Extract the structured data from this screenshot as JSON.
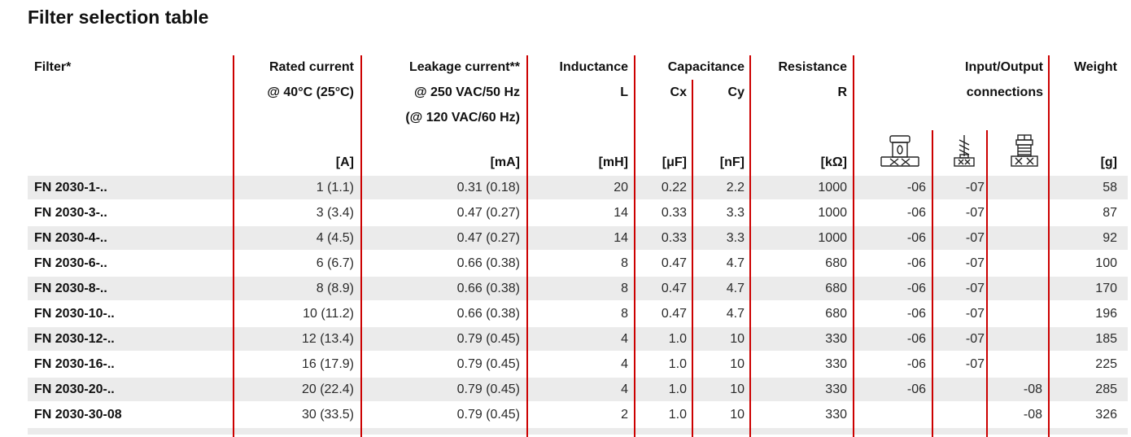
{
  "title": "Filter selection table",
  "header": {
    "filter": "Filter*",
    "rated_current": "Rated current",
    "rated_current_sub": "@ 40°C (25°C)",
    "rated_current_unit": "[A]",
    "leakage": "Leakage current**",
    "leakage_sub1": "@ 250 VAC/50 Hz",
    "leakage_sub2": "(@ 120 VAC/60 Hz)",
    "leakage_unit": "[mA]",
    "inductance": "Inductance",
    "inductance_sub": "L",
    "inductance_unit": "[mH]",
    "capacitance": "Capacitance",
    "cx": "Cx",
    "cx_unit": "[μF]",
    "cy": "Cy",
    "cy_unit": "[nF]",
    "resistance": "Resistance",
    "resistance_sub": "R",
    "resistance_unit": "[kΩ]",
    "io": "Input/Output",
    "io_sub": "connections",
    "weight": "Weight",
    "weight_unit": "[g]"
  },
  "icons": [
    "terminal-block-icon",
    "fast-on-terminal-icon",
    "screw-terminal-icon"
  ],
  "rows": [
    {
      "name": "FN 2030-1-..",
      "rated": "1 (1.1)",
      "leakage": "0.31 (0.18)",
      "l": "20",
      "cx": "0.22",
      "cy": "2.2",
      "r": "1000",
      "c06": "-06",
      "c07": "-07",
      "c08": "",
      "weight": "58"
    },
    {
      "name": "FN 2030-3-..",
      "rated": "3 (3.4)",
      "leakage": "0.47 (0.27)",
      "l": "14",
      "cx": "0.33",
      "cy": "3.3",
      "r": "1000",
      "c06": "-06",
      "c07": "-07",
      "c08": "",
      "weight": "87"
    },
    {
      "name": "FN 2030-4-..",
      "rated": "4 (4.5)",
      "leakage": "0.47 (0.27)",
      "l": "14",
      "cx": "0.33",
      "cy": "3.3",
      "r": "1000",
      "c06": "-06",
      "c07": "-07",
      "c08": "",
      "weight": "92"
    },
    {
      "name": "FN 2030-6-..",
      "rated": "6 (6.7)",
      "leakage": "0.66 (0.38)",
      "l": "8",
      "cx": "0.47",
      "cy": "4.7",
      "r": "680",
      "c06": "-06",
      "c07": "-07",
      "c08": "",
      "weight": "100"
    },
    {
      "name": "FN 2030-8-..",
      "rated": "8 (8.9)",
      "leakage": "0.66 (0.38)",
      "l": "8",
      "cx": "0.47",
      "cy": "4.7",
      "r": "680",
      "c06": "-06",
      "c07": "-07",
      "c08": "",
      "weight": "170"
    },
    {
      "name": "FN 2030-10-..",
      "rated": "10 (11.2)",
      "leakage": "0.66 (0.38)",
      "l": "8",
      "cx": "0.47",
      "cy": "4.7",
      "r": "680",
      "c06": "-06",
      "c07": "-07",
      "c08": "",
      "weight": "196"
    },
    {
      "name": "FN 2030-12-..",
      "rated": "12 (13.4)",
      "leakage": "0.79 (0.45)",
      "l": "4",
      "cx": "1.0",
      "cy": "10",
      "r": "330",
      "c06": "-06",
      "c07": "-07",
      "c08": "",
      "weight": "185"
    },
    {
      "name": "FN 2030-16-..",
      "rated": "16 (17.9)",
      "leakage": "0.79 (0.45)",
      "l": "4",
      "cx": "1.0",
      "cy": "10",
      "r": "330",
      "c06": "-06",
      "c07": "-07",
      "c08": "",
      "weight": "225"
    },
    {
      "name": "FN 2030-20-..",
      "rated": "20 (22.4)",
      "leakage": "0.79 (0.45)",
      "l": "4",
      "cx": "1.0",
      "cy": "10",
      "r": "330",
      "c06": "-06",
      "c07": "",
      "c08": "-08",
      "weight": "285"
    },
    {
      "name": "FN 2030-30-08",
      "rated": "30 (33.5)",
      "leakage": "0.79 (0.45)",
      "l": "2",
      "cx": "1.0",
      "cy": "10",
      "r": "330",
      "c06": "",
      "c07": "",
      "c08": "-08",
      "weight": "326"
    }
  ]
}
